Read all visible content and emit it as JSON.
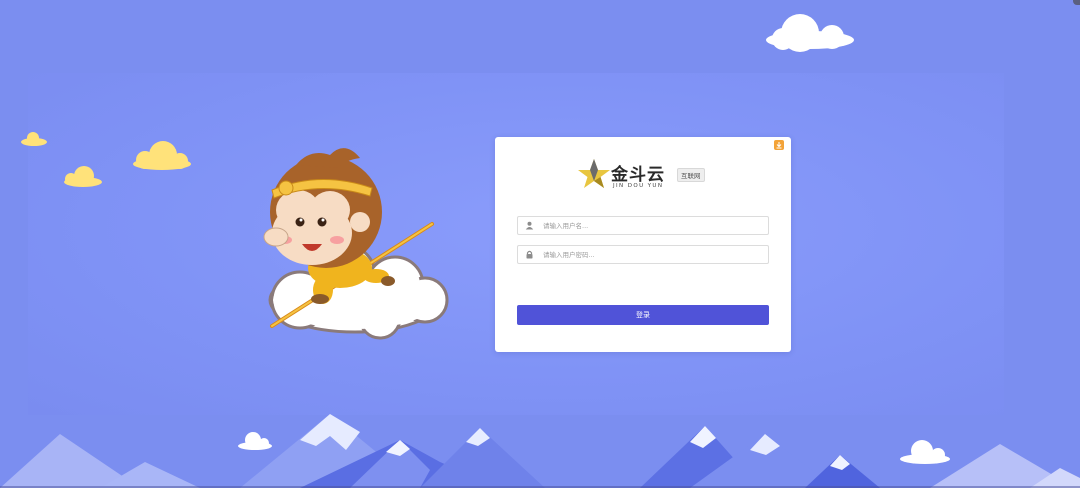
{
  "brand": {
    "name_cn": "金斗云",
    "name_en": "JIN DOU YUN",
    "tag": "互联网"
  },
  "login": {
    "username_placeholder": "请输入用户名...",
    "password_placeholder": "请输入用户密码...",
    "submit_label": "登录"
  },
  "icons": {
    "download": "download-icon",
    "user": "user-icon",
    "lock": "lock-icon",
    "logo": "star-logo-icon"
  },
  "colors": {
    "background": "#7b8ef0",
    "panel": "#8a9cfb",
    "button": "#5053d8",
    "download_badge": "#f3a338",
    "cloud_yellow": "#ffe27a"
  }
}
